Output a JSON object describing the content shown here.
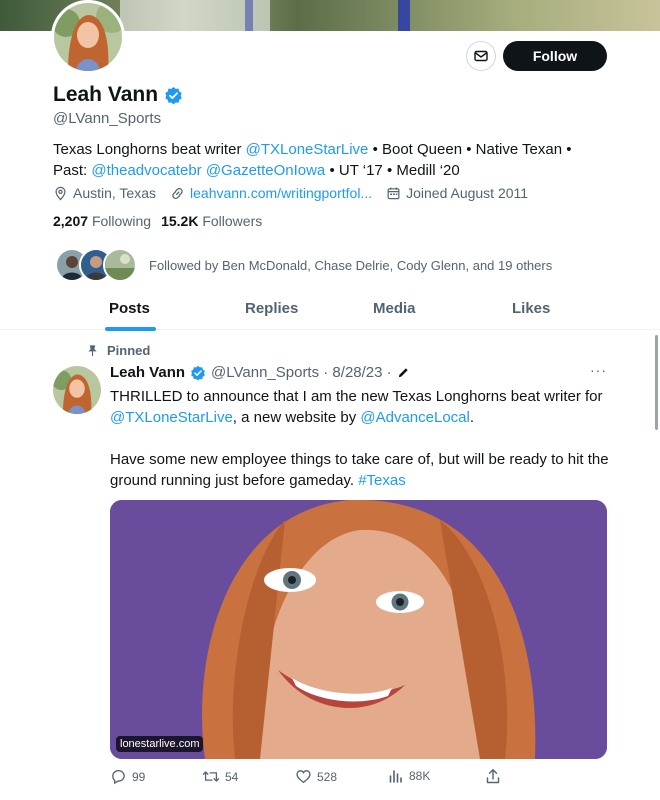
{
  "profile": {
    "name": "Leah Vann",
    "handle": "@LVann_Sports",
    "follow_label": "Follow",
    "bio": {
      "p1": "Texas Longhorns beat writer ",
      "m1": "@TXLoneStarLive",
      "p2": " • Boot Queen • Native Texan •",
      "p3": "Past: ",
      "m2": "@theadvocatebr",
      "m3": "@GazetteOnIowa",
      "p4": " • UT ‘17 • Medill ‘20"
    },
    "location": "Austin, Texas",
    "website": "leahvann.com/writingportfol...",
    "joined": "Joined August 2011",
    "following_count": "2,207",
    "following_label": "Following",
    "followers_count": "15.2K",
    "followers_label": "Followers",
    "followed_by": "Followed by Ben McDonald, Chase Delrie, Cody Glenn, and 19 others"
  },
  "tabs": [
    "Posts",
    "Replies",
    "Media",
    "Likes"
  ],
  "post": {
    "pinned_label": "Pinned",
    "name": "Leah Vann",
    "handle_date": "@LVann_Sports · 8/28/23 ·",
    "text_a": "THRILLED to announce that I am the new Texas Longhorns beat writer for ",
    "mention1": "@TXLoneStarLive",
    "text_b": ", a new website by ",
    "mention2": "@AdvanceLocal",
    "text_c": ".",
    "text_d": "Have some new employee things to take care of, but will be ready to hit the ground running just before gameday. ",
    "hashtag": "#Texas",
    "media_source": "lonestarlive.com",
    "replies": "99",
    "reposts": "54",
    "likes": "528",
    "views": "88K"
  },
  "colors": {
    "accent": "#1d9bf0",
    "text": "#0f1419",
    "muted": "#536471",
    "media_bg": "#6a4c9c"
  }
}
